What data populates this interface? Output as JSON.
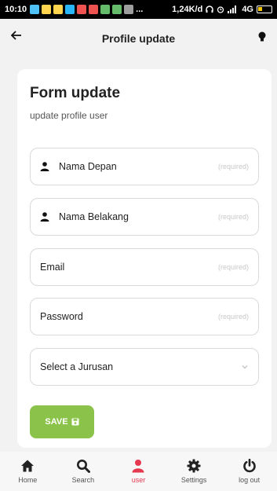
{
  "status_bar": {
    "time": "10:10",
    "network_speed": "1,24K/d",
    "network_type": "4G",
    "overflow": "..."
  },
  "header": {
    "title": "Profile update"
  },
  "form": {
    "title": "Form update",
    "subtitle": "update profile user",
    "fields": [
      {
        "label": "Nama Depan",
        "hint": "(required)",
        "icon": "person-icon"
      },
      {
        "label": "Nama Belakang",
        "hint": "(required)",
        "icon": "person-icon"
      },
      {
        "label": "Email",
        "hint": "(required)"
      },
      {
        "label": "Password",
        "hint": "(required)"
      }
    ],
    "select": {
      "value": "Select a Jurusan"
    },
    "save_label": "SAVE"
  },
  "nav": {
    "items": [
      {
        "label": "Home",
        "icon": "home-icon"
      },
      {
        "label": "Search",
        "icon": "search-icon"
      },
      {
        "label": "user",
        "icon": "user-icon",
        "active": true
      },
      {
        "label": "Settings",
        "icon": "gear-icon"
      },
      {
        "label": "log out",
        "icon": "power-icon"
      }
    ]
  },
  "colors": {
    "accent": "#8bc34a",
    "active": "#e53950"
  }
}
